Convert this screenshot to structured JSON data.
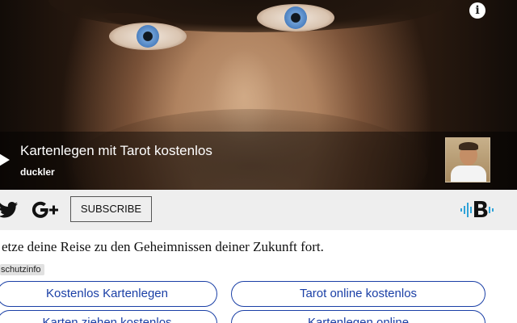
{
  "video": {
    "title": "Kartenlegen mit Tarot kostenlos",
    "channel": "duckler",
    "info_icon": "info-icon",
    "info_glyph": "i",
    "play_icon": "play-icon"
  },
  "social": {
    "icons": [
      "twitter-icon",
      "google-plus-icon"
    ],
    "subscribe_label": "SUBSCRIBE",
    "brand_icon": "bitchute-style-logo-icon",
    "brand_color": "#2fa3d8"
  },
  "content": {
    "intro": "etze deine Reise zu den Geheimnissen deiner Zukunft fort.",
    "privacy_tag": "schutzinfo"
  },
  "links": [
    {
      "label": "Kostenlos Kartenlegen"
    },
    {
      "label": "Tarot online kostenlos"
    },
    {
      "label": "Karten ziehen kostenlos"
    },
    {
      "label": "Kartenlegen online"
    }
  ],
  "colors": {
    "link": "#1a3fa6",
    "social_bar": "#eeeeee",
    "overlay": "rgba(0,0,0,0.42)"
  }
}
